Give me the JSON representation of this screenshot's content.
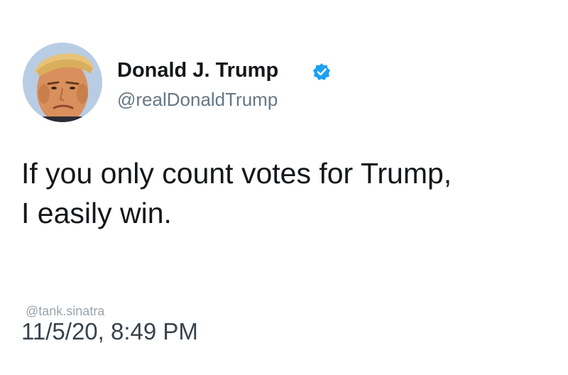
{
  "tweet": {
    "display_name": "Donald J. Trump",
    "handle": "@realDonaldTrump",
    "verified_icon": "verified-badge-icon",
    "verified_color": "#1da1f2",
    "avatar_icon": "profile-photo",
    "body_lines": [
      "If you only count votes for Trump,",
      "I easily win."
    ],
    "watermark": "@tank.sinatra",
    "timestamp": "11/5/20, 8:49 PM"
  }
}
